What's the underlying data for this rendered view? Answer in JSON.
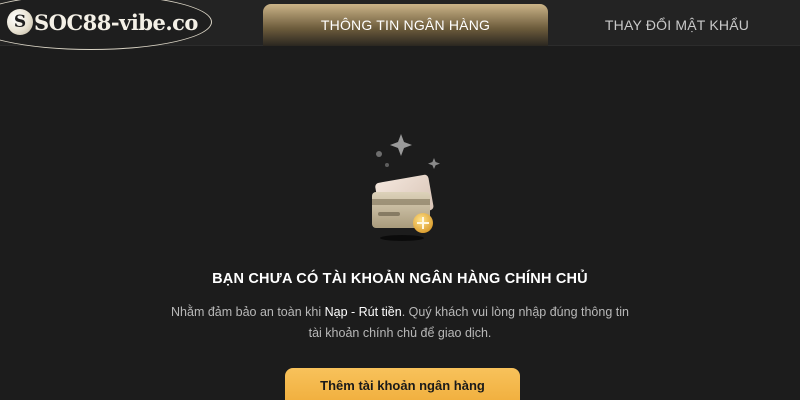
{
  "header": {
    "logo_mark": "S",
    "logo_text": "SOC88-vibe.co",
    "tabs": [
      {
        "label": "THÔNG TIN NGÂN HÀNG",
        "active": true
      },
      {
        "label": "THAY ĐỔI MẬT KHẨU",
        "active": false
      }
    ]
  },
  "main": {
    "icon": "bank-card-add-icon",
    "title": "BẠN CHƯA CÓ TÀI KHOẢN NGÂN HÀNG CHÍNH CHỦ",
    "desc_part1": "Nhằm đảm bảo an toàn khi ",
    "desc_highlight": "Nạp - Rút tiền",
    "desc_part2": ". Quý khách vui lòng nhập đúng thông tin tài khoản chính chủ để giao dịch.",
    "add_button": "Thêm tài khoản ngân hàng"
  },
  "colors": {
    "background": "#1c1c1c",
    "tab_active": "#cbb488",
    "button": "#f3b545"
  }
}
